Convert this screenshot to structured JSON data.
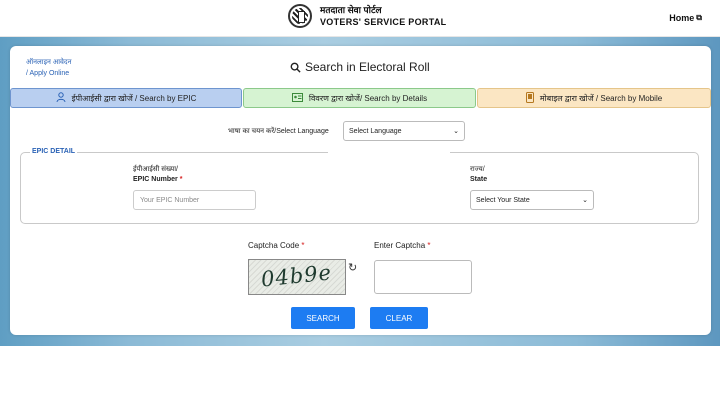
{
  "header": {
    "portal_hindi": "मतदाता सेवा पोर्टल",
    "portal_english": "VOTERS' SERVICE PORTAL",
    "home_label": "Home",
    "home_icon": "external-link-icon"
  },
  "sidebar_link": {
    "line1": "ऑनलाइन आवेदन",
    "line2": "/ Apply Online"
  },
  "page": {
    "title": "Search in Electoral Roll",
    "title_icon": "search-icon"
  },
  "tabs": [
    {
      "label": "ईपीआईसी द्वारा खोजें / Search by EPIC",
      "icon": "user-icon",
      "active": true
    },
    {
      "label": "विवरण द्वारा खोजें/ Search by Details",
      "icon": "id-card-icon",
      "active": false
    },
    {
      "label": "मोबाइल द्वारा खोजें / Search by Mobile",
      "icon": "mobile-icon",
      "active": false
    }
  ],
  "language": {
    "label": "भाषा का चयन करें/Select Language",
    "selected": "Select Language"
  },
  "epic_detail": {
    "legend": "EPIC DETAIL",
    "epic_label_hi": "ईपीआईसी संख्या/",
    "epic_label_en": "EPIC Number",
    "epic_placeholder": "Your EPIC Number",
    "state_label_hi": "राज्य/",
    "state_label_en": "State",
    "state_selected": "Select Your State"
  },
  "captcha": {
    "code_label": "Captcha Code",
    "captcha_text": "04b9e",
    "enter_label": "Enter Captcha",
    "required_mark": "*"
  },
  "buttons": {
    "search": "SEARCH",
    "clear": "CLEAR"
  },
  "colors": {
    "accent": "#1d7cf2",
    "link": "#2a62b5",
    "tab_epic": "#b9cff0",
    "tab_details": "#d6f3d2",
    "tab_mobile": "#fbe6c3",
    "required": "#d62020"
  }
}
